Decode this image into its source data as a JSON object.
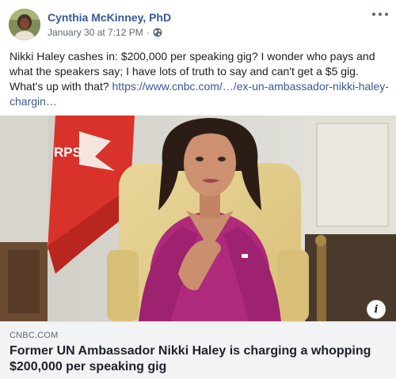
{
  "post": {
    "author": "Cynthia McKinney, PhD",
    "timestamp": "January 30 at 7:12 PM",
    "separator": "·",
    "privacy_icon": "globe-icon",
    "more_icon": "more-options-icon",
    "text_before_link": "Nikki Haley cashes in: $200,000 per speaking gig? I wonder who pays and what the speakers say; I have lots of truth to say and can't get a $5 gig. What's up with that? ",
    "link_text": "https://www.cnbc.com/…/ex-un-ambassador-nikki-haley-chargin…"
  },
  "link_preview": {
    "image_banner_text": "RPS",
    "info_icon": "info-icon",
    "info_label": "i",
    "domain": "CNBC.COM",
    "headline": "Former UN Ambassador Nikki Haley is charging a whopping $200,000 per speaking gig"
  },
  "colors": {
    "author_link": "#385898",
    "caption_background": "#f2f3f5",
    "meta_text": "#616770"
  }
}
